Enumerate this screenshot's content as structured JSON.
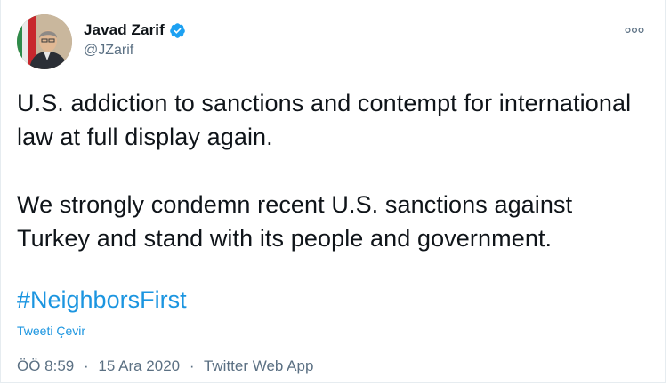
{
  "author": {
    "display_name": "Javad Zarif",
    "handle": "@JZarif",
    "verified": true
  },
  "icons": {
    "verified": "verified-badge-icon",
    "more": "more-options-icon",
    "avatar": "profile-avatar"
  },
  "tweet": {
    "paragraph_1": "U.S. addiction to sanctions and contempt for international law at full display again.",
    "paragraph_2": "We strongly condemn recent U.S. sanctions against Turkey and stand with its people and government.",
    "hashtag": "#NeighborsFirst"
  },
  "translate_label": "Tweeti Çevir",
  "meta": {
    "time": "ÖÖ 8:59",
    "separator": "·",
    "date": "15 Ara 2020",
    "source": "Twitter Web App"
  },
  "colors": {
    "link": "#1b95e0",
    "verified": "#1da1f2",
    "secondary_text": "#5b7083"
  }
}
